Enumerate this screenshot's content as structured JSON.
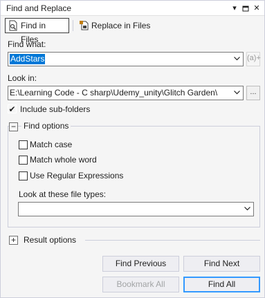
{
  "window": {
    "title": "Find and Replace",
    "dropdown_glyph": "▾",
    "pin_glyph": "⊓",
    "close_glyph": "✕"
  },
  "tabs": [
    {
      "label": "Find in Files",
      "icon": "find-in-files-icon",
      "active": true
    },
    {
      "label": "Replace in Files",
      "icon": "replace-in-files-icon",
      "active": false
    }
  ],
  "find": {
    "label": "Find what:",
    "value": "AddStars",
    "expr_button": "(a)+"
  },
  "look_in": {
    "label": "Look in:",
    "value": "E:\\Learning Code - C sharp\\Udemy_unity\\Glitch Garden\\",
    "browse_button": "..."
  },
  "include_subfolders": {
    "label": "Include sub-folders",
    "checked": true
  },
  "find_options": {
    "title": "Find options",
    "expander": "−",
    "match_case": {
      "label": "Match case",
      "checked": false
    },
    "match_whole_word": {
      "label": "Match whole word",
      "checked": false
    },
    "use_regex": {
      "label": "Use Regular Expressions",
      "checked": false
    },
    "file_types_label": "Look at these file types:",
    "file_types_value": ""
  },
  "result_options": {
    "title": "Result options",
    "expander": "+"
  },
  "buttons": {
    "find_previous": "Find Previous",
    "find_next": "Find Next",
    "bookmark_all": "Bookmark All",
    "find_all": "Find All"
  },
  "check_glyph": "✔",
  "combo_arrow": "⌵",
  "colors": {
    "selection": "#0078d7",
    "default_button_border": "#3399ff",
    "disabled_text": "#a2a4a5"
  }
}
